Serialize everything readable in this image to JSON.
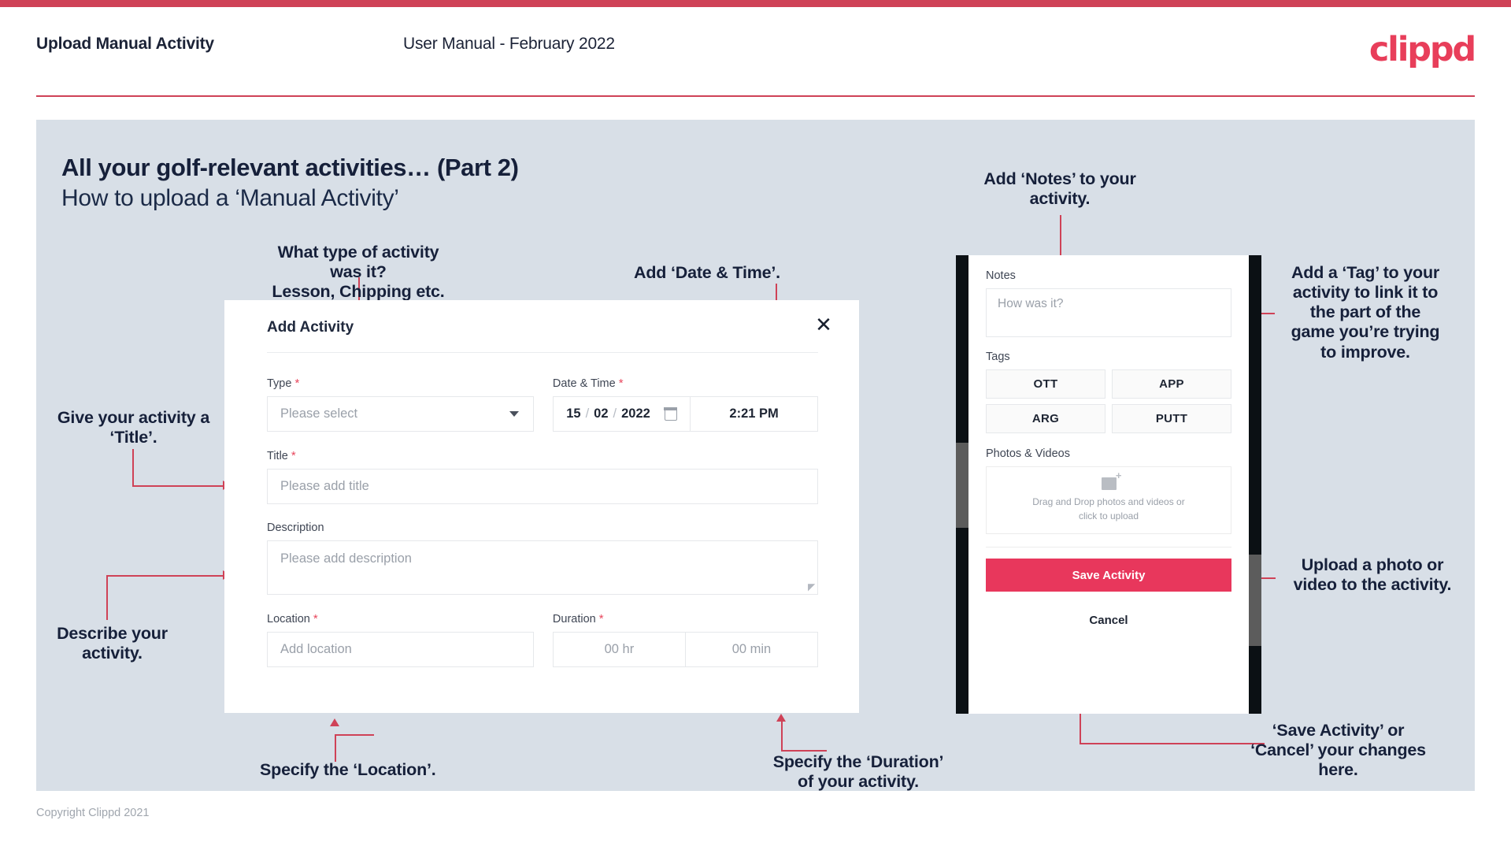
{
  "header": {
    "title": "Upload Manual Activity",
    "subtitle": "User Manual - February 2022",
    "logo": "clippd"
  },
  "slide": {
    "title": "All your golf-relevant activities… (Part 2)",
    "subtitle": "How to upload a ‘Manual Activity’"
  },
  "annotations": {
    "type": "What type of activity was it?\nLesson, Chipping etc.",
    "type_line1": "What type of activity was it?",
    "type_line2": "Lesson, Chipping etc.",
    "datetime": "Add ‘Date & Time’.",
    "title": "Give your activity a\n‘Title’.",
    "title_line1": "Give your activity a",
    "title_line2": "‘Title’.",
    "description_line1": "Describe your",
    "description_line2": "activity.",
    "location": "Specify the ‘Location’.",
    "duration_line1": "Specify the ‘Duration’",
    "duration_line2": "of your activity.",
    "notes_line1": "Add ‘Notes’ to your",
    "notes_line2": "activity.",
    "tags_line1": "Add a ‘Tag’ to your",
    "tags_line2": "activity to link it to",
    "tags_line3": "the part of the",
    "tags_line4": "game you’re trying",
    "tags_line5": "to improve.",
    "upload_line1": "Upload a photo or",
    "upload_line2": "video to the activity.",
    "save_line1": "‘Save Activity’ or",
    "save_line2": "‘Cancel’ your changes",
    "save_line3": "here."
  },
  "modal": {
    "title": "Add Activity",
    "close_icon": "close-icon",
    "fields": {
      "type": {
        "label": "Type",
        "required": "*",
        "placeholder": "Please select"
      },
      "datetime": {
        "label": "Date & Time",
        "required": "*",
        "day": "15",
        "month": "02",
        "year": "2022",
        "sep": "/",
        "time": "2:21 PM"
      },
      "title": {
        "label": "Title",
        "required": "*",
        "placeholder": "Please add title"
      },
      "description": {
        "label": "Description",
        "required": "",
        "placeholder": "Please add description"
      },
      "location": {
        "label": "Location",
        "required": "*",
        "placeholder": "Add location"
      },
      "duration": {
        "label": "Duration",
        "required": "*",
        "hours_placeholder": "00 hr",
        "minutes_placeholder": "00 min"
      }
    }
  },
  "phone": {
    "notes": {
      "label": "Notes",
      "placeholder": "How was it?"
    },
    "tags": {
      "label": "Tags",
      "items": [
        "OTT",
        "APP",
        "ARG",
        "PUTT"
      ]
    },
    "photos": {
      "label": "Photos & Videos",
      "drop_line1": "Drag and Drop photos and videos or",
      "drop_line2": "click to upload"
    },
    "save_label": "Save Activity",
    "cancel_label": "Cancel"
  },
  "footer": {
    "copyright": "Copyright Clippd 2021"
  },
  "colors": {
    "accent": "#cf4257",
    "brand": "#e83e5a",
    "save": "#e8375c",
    "slide_bg": "#d8dfe7",
    "text": "#16203a"
  }
}
